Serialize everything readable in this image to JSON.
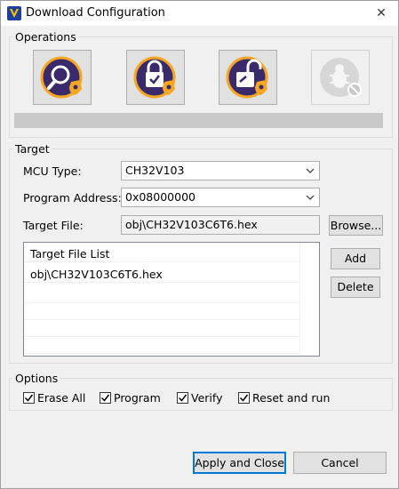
{
  "window": {
    "title": "Download Configuration",
    "close_glyph": "✕"
  },
  "operations": {
    "legend": "Operations",
    "buttons": [
      {
        "icon": "search-shield-icon",
        "enabled": true
      },
      {
        "icon": "lock-shield-icon",
        "enabled": true
      },
      {
        "icon": "unlock-shield-icon",
        "enabled": true
      },
      {
        "icon": "bug-disabled-icon",
        "enabled": false
      }
    ],
    "progress_percent": 0
  },
  "target": {
    "legend": "Target",
    "mcu_type_label": "MCU Type:",
    "mcu_type_value": "CH32V103",
    "program_address_label": "Program Address:",
    "program_address_value": "0x08000000",
    "target_file_label": "Target File:",
    "target_file_value": "obj\\CH32V103C6T6.hex",
    "browse_label": "Browse...",
    "list_header": "Target File List",
    "list_items": [
      "obj\\CH32V103C6T6.hex"
    ],
    "add_label": "Add",
    "delete_label": "Delete"
  },
  "options": {
    "legend": "Options",
    "items": [
      {
        "label": "Erase All",
        "checked": true
      },
      {
        "label": "Program",
        "checked": true
      },
      {
        "label": "Verify",
        "checked": true
      },
      {
        "label": "Reset and run",
        "checked": true
      }
    ]
  },
  "footer": {
    "apply_label": "Apply and Close",
    "cancel_label": "Cancel"
  },
  "colors": {
    "accent": "#0078d7",
    "icon_purple": "#3a2a6b",
    "icon_orange": "#f5a623"
  }
}
